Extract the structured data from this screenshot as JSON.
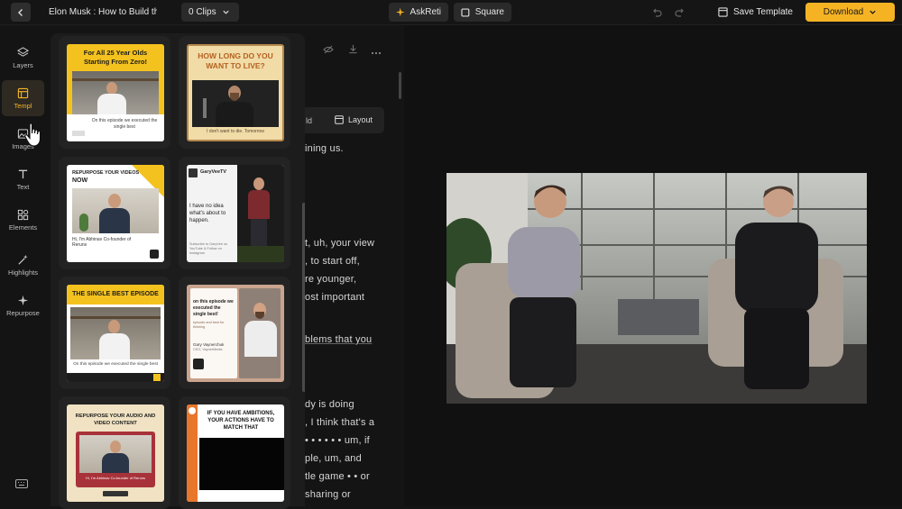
{
  "topbar": {
    "project_title": "Elon Musk : How to Build th",
    "clips_label": "0 Clips",
    "askreti_label": "AskReti",
    "aspect_label": "Square",
    "save_template_label": "Save Template",
    "download_label": "Download",
    "icons": [
      "back-arrow-icon",
      "chevron-down-icon",
      "sparkle-icon",
      "square-icon",
      "undo-icon",
      "redo-icon",
      "save-template-icon",
      "chevron-down-icon"
    ]
  },
  "sidebar": {
    "items": [
      {
        "label": "Layers",
        "icon": "layers-icon"
      },
      {
        "label": "Templ",
        "icon": "template-icon",
        "active": true
      },
      {
        "label": "Images",
        "icon": "image-icon"
      },
      {
        "label": "Text",
        "icon": "text-icon"
      },
      {
        "label": "Elements",
        "icon": "elements-icon"
      },
      {
        "label": "Highlights",
        "icon": "highlights-icon"
      },
      {
        "label": "Repurpose",
        "icon": "repurpose-icon"
      }
    ],
    "bottom_icon": "keyboard-icon"
  },
  "templates": [
    {
      "headline": "For All 25 Year Olds Starting From Zero!",
      "caption": "On this episode we executed the single best"
    },
    {
      "headline": "HOW LONG DO YOU WANT TO LIVE?",
      "caption": "I don't want to die. Tomorrow"
    },
    {
      "headline": "REPURPOSE YOUR VIDEOS",
      "headline2": "NOW",
      "caption": "Hi, I'm Abhinav Co-founder of Reruns"
    },
    {
      "channel": "GaryVeeTV",
      "body": "I have no idea what's about to happen.",
      "caption": "Subscribe to GaryVee on YouTube & Follow on Instagram"
    },
    {
      "headline": "THE SINGLE BEST EPISODE",
      "caption": "On this episode we executed the single best"
    },
    {
      "body": "on this episode we executed the single best!",
      "sub": "episode and best for thinking",
      "name": "Gary Vaynerchuk",
      "role": "CEO, VaynerMedia"
    },
    {
      "headline": "REPURPOSE YOUR AUDIO AND VIDEO CONTENT",
      "caption": "Hi, I'm Abhinav Co-founder of Reruns"
    },
    {
      "headline": "IF YOU HAVE AMBITIONS, YOUR ACTIONS HAVE TO MATCH THAT"
    }
  ],
  "editor": {
    "tab_layout": "Layout",
    "tab_partial": "ld",
    "lines": [
      "ining us.",
      "t, uh, your view",
      ", to start off,",
      "re younger,",
      "ost important",
      "blems that you",
      "dy is doing",
      ", I think that's a",
      "• • • • • • um, if",
      "ple, um, and",
      "tle game • • or",
      "sharing or"
    ],
    "icons": [
      "eye-off-icon",
      "download-icon",
      "more-icon"
    ]
  },
  "colors": {
    "accent": "#f5b324",
    "background": "#141414",
    "panel": "#1c1c1c"
  }
}
